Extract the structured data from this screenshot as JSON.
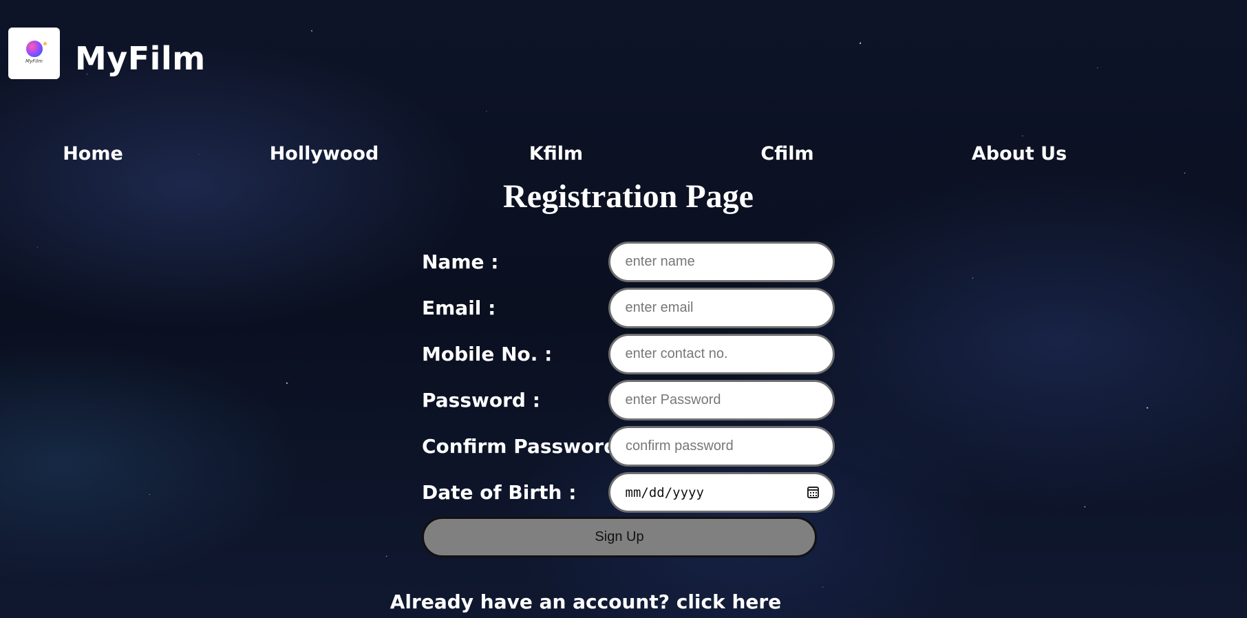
{
  "header": {
    "logo_text": "MyFilm",
    "brand": "MyFilm"
  },
  "nav": {
    "items": [
      "Home",
      "Hollywood",
      "Kfilm",
      "Cfilm",
      "About Us"
    ]
  },
  "page_title": "Registration Page",
  "form": {
    "name": {
      "label": "Name :",
      "placeholder": "enter name"
    },
    "email": {
      "label": "Email :",
      "placeholder": "enter email"
    },
    "mobile": {
      "label": "Mobile No. :",
      "placeholder": "enter contact no."
    },
    "password": {
      "label": "Password :",
      "placeholder": "enter Password"
    },
    "confirm_password": {
      "label": "Confirm Password :",
      "placeholder": "confirm password"
    },
    "dob": {
      "label": "Date of Birth :",
      "value": "mm/dd/yyyy"
    },
    "submit_label": "Sign Up"
  },
  "login_prompt": "Already have an account? click here",
  "colors": {
    "background": "#0c1224",
    "text": "#ffffff",
    "button": "#808080",
    "input_border": "#6f6f6f"
  }
}
